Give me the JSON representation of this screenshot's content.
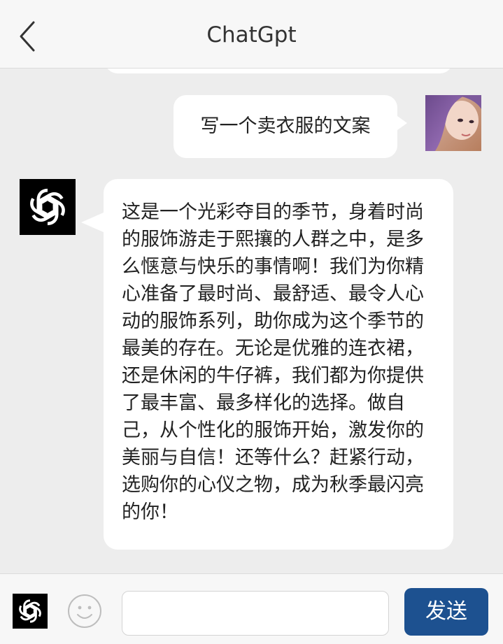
{
  "header": {
    "title": "ChatGpt",
    "back_icon": "chevron-left-icon"
  },
  "messages": [
    {
      "role": "user",
      "text": "写一个卖衣服的文案",
      "avatar": "user-avatar-photo"
    },
    {
      "role": "assistant",
      "text": "这是一个光彩夺目的季节，身着时尚的服饰游走于熙攘的人群之中，是多么惬意与快乐的事情啊！我们为你精心准备了最时尚、最舒适、最令人心动的服饰系列，助你成为这个季节的最美的存在。无论是优雅的连衣裙，还是休闲的牛仔裤，我们都为你提供了最丰富、最多样化的选择。做自己，从个性化的服饰开始，激发你的美丽与自信！还等什么？赶紧行动，选购你的心仪之物，成为秋季最闪亮的你！",
      "avatar": "openai-logo-icon"
    }
  ],
  "footer": {
    "logo_icon": "openai-logo-icon",
    "emoji_icon": "smiley-icon",
    "input_value": "",
    "input_placeholder": "",
    "send_label": "发送"
  },
  "colors": {
    "background": "#ededed",
    "bar": "#f7f7f7",
    "bubble": "#ffffff",
    "send_button": "#1d5190"
  }
}
